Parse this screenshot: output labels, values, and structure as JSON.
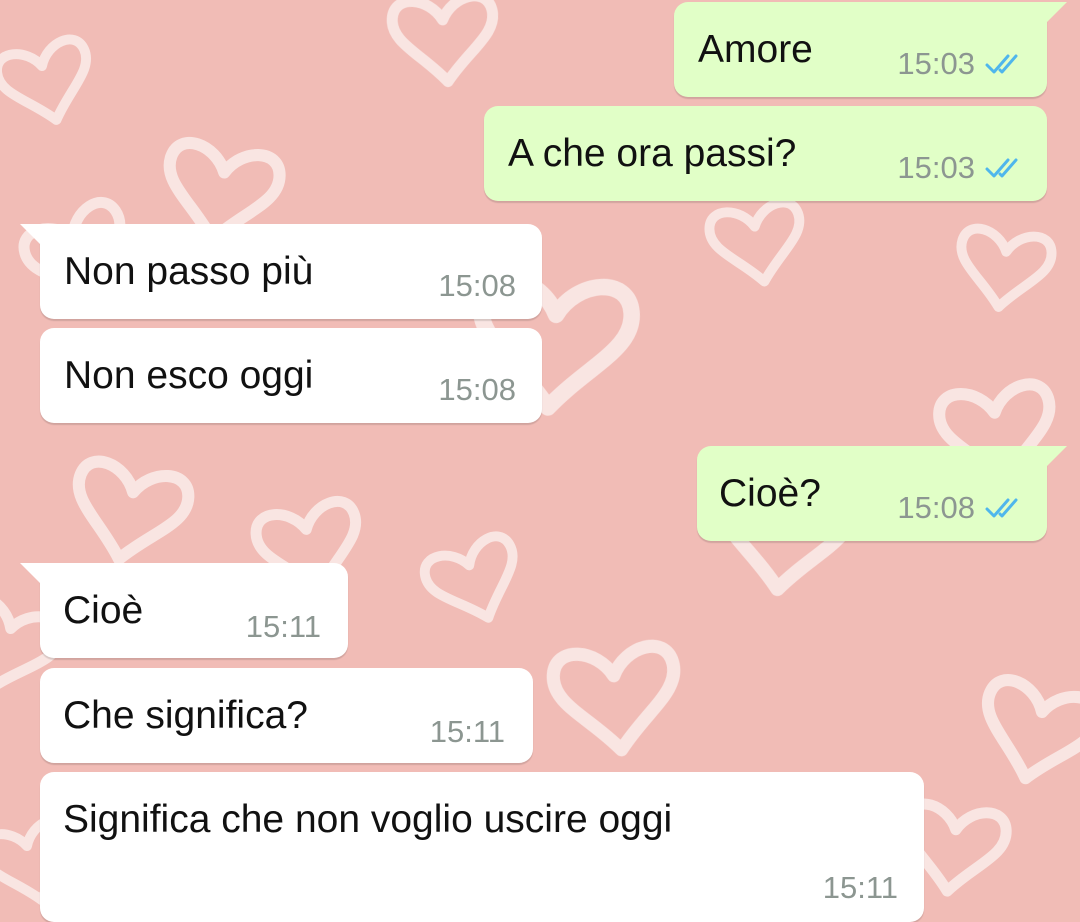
{
  "colors": {
    "wallpaper": "#f1bcb6",
    "hearts": "#ffffff",
    "outgoing_bubble": "#e1ffc7",
    "incoming_bubble": "#ffffff",
    "text": "#111111",
    "timestamp": "#8c9691",
    "read_receipt": "#4fb6ec"
  },
  "messages": [
    {
      "direction": "outgoing",
      "text": "Amore",
      "time": "15:03",
      "status_icon": "double-check-read-icon"
    },
    {
      "direction": "outgoing",
      "text": "A che ora passi?",
      "time": "15:03",
      "status_icon": "double-check-read-icon"
    },
    {
      "direction": "incoming",
      "text": "Non passo più",
      "time": "15:08"
    },
    {
      "direction": "incoming",
      "text": "Non esco oggi",
      "time": "15:08"
    },
    {
      "direction": "outgoing",
      "text": "Cioè?",
      "time": "15:08",
      "status_icon": "double-check-read-icon"
    },
    {
      "direction": "incoming",
      "text": "Cioè",
      "time": "15:11"
    },
    {
      "direction": "incoming",
      "text": "Che significa?",
      "time": "15:11"
    },
    {
      "direction": "incoming",
      "text": "Significa che non voglio uscire oggi",
      "time": "15:11"
    }
  ]
}
